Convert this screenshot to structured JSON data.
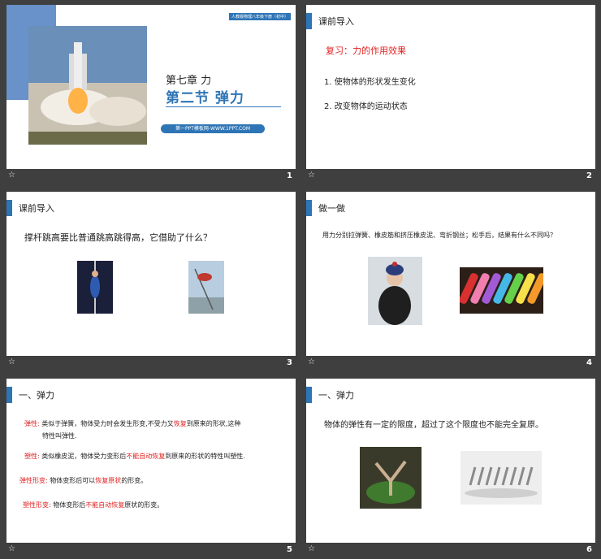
{
  "slides": [
    {
      "num": "1",
      "tag": "人教版物理八年级下册（初中）",
      "chapter": "第七章  力",
      "section": "第二节  弹力",
      "site": "第一PPT模板网-WWW.1PPT.COM"
    },
    {
      "num": "2",
      "header": "课前导入",
      "review": "复习：力的作用效果",
      "item1": "1. 使物体的形状发生变化",
      "item2": "2. 改变物体的运动状态"
    },
    {
      "num": "3",
      "header": "课前导入",
      "question": "撑杆跳高要比普通跳高跳得高，它借助了什么？"
    },
    {
      "num": "4",
      "header": "做一做",
      "text": "用力分别拉弹簧、橡皮筋和挤压橡皮泥、弯折钢丝；松手后，结果有什么不同吗？"
    },
    {
      "num": "5",
      "header": "一、弹力",
      "p1_label": "弹性:",
      "p1_a": "类似于弹簧，物体受力时会发生形变,不受力又",
      "p1_red": "恢复",
      "p1_b": "到原来的形状,这种",
      "p1_c": "特性叫弹性.",
      "p2_label": "塑性:",
      "p2_a": "类似橡皮泥，物体受力变形后",
      "p2_red": "不能自动恢复",
      "p2_b": "到原来的形状的特性叫塑性.",
      "p3_label": "弹性形变:",
      "p3_a": "物体变形后可以",
      "p3_red": "恢复原状",
      "p3_b": "的形变。",
      "p4_label": "塑性形变:",
      "p4_a": "物体变形后",
      "p4_red": "不能自动恢复",
      "p4_b": "原状的形变。"
    },
    {
      "num": "6",
      "header": "一、弹力",
      "text": "物体的弹性有一定的限度，超过了这个限度也不能完全复原。"
    }
  ],
  "footer_star": "☆"
}
